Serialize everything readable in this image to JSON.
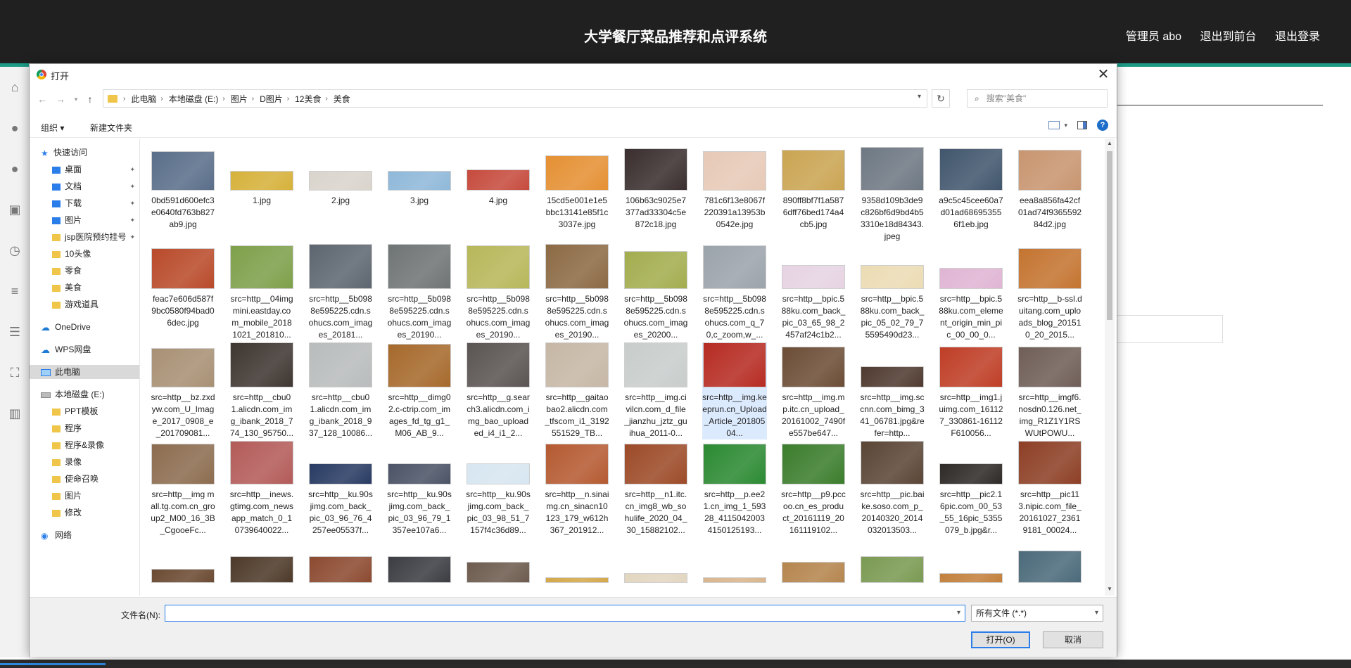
{
  "app": {
    "system_title": "大学餐厅菜品推荐和点评系统",
    "nav": {
      "admin": "管理员 abo",
      "front": "退出到前台",
      "logout": "退出登录"
    }
  },
  "dialog": {
    "title": "打开",
    "breadcrumb": [
      "此电脑",
      "本地磁盘 (E:)",
      "图片",
      "D图片",
      "12美食",
      "美食"
    ],
    "search_placeholder": "搜索\"美食\"",
    "toolbar": {
      "organize": "组织 ▾",
      "new_folder": "新建文件夹"
    },
    "nav_pane": [
      {
        "label": "快速访问",
        "icon": "star-icon",
        "indent": 0
      },
      {
        "label": "桌面",
        "icon": "desktop-icon",
        "indent": 1,
        "pinned": true
      },
      {
        "label": "文档",
        "icon": "document-icon",
        "indent": 1,
        "pinned": true
      },
      {
        "label": "下载",
        "icon": "download-icon",
        "indent": 1,
        "pinned": true
      },
      {
        "label": "图片",
        "icon": "picture-icon",
        "indent": 1,
        "pinned": true
      },
      {
        "label": "jsp医院预约挂号",
        "icon": "folder-icon",
        "indent": 1,
        "pinned": true
      },
      {
        "label": "10头像",
        "icon": "folder-icon",
        "indent": 1
      },
      {
        "label": "零食",
        "icon": "folder-icon",
        "indent": 1
      },
      {
        "label": "美食",
        "icon": "folder-icon",
        "indent": 1
      },
      {
        "label": "游戏道具",
        "icon": "folder-icon",
        "indent": 1
      },
      {
        "label": "OneDrive",
        "icon": "cloud-icon",
        "indent": 0,
        "gap": true
      },
      {
        "label": "WPS网盘",
        "icon": "cloud-icon",
        "indent": 0,
        "gap": true
      },
      {
        "label": "此电脑",
        "icon": "computer-icon",
        "indent": 0,
        "gap": true,
        "selected": true
      },
      {
        "label": "本地磁盘 (E:)",
        "icon": "drive-icon",
        "indent": 0,
        "gap": true
      },
      {
        "label": "PPT模板",
        "icon": "folder-icon",
        "indent": 1
      },
      {
        "label": "程序",
        "icon": "folder-icon",
        "indent": 1
      },
      {
        "label": "程序&录像",
        "icon": "folder-icon",
        "indent": 1
      },
      {
        "label": "录像",
        "icon": "folder-icon",
        "indent": 1
      },
      {
        "label": "使命召唤",
        "icon": "folder-icon",
        "indent": 1
      },
      {
        "label": "图片",
        "icon": "folder-icon",
        "indent": 1
      },
      {
        "label": "修改",
        "icon": "folder-icon",
        "indent": 1
      },
      {
        "label": "网络",
        "icon": "network-icon",
        "indent": 0,
        "gap": true
      }
    ],
    "files": [
      {
        "name": "0bd591d600efc3e0640fd763b827ab9.jpg",
        "color": "#5a6e8a",
        "h": 56
      },
      {
        "name": "1.jpg",
        "color": "#d6b13a",
        "h": 28
      },
      {
        "name": "2.jpg",
        "color": "#d9d4cc",
        "h": 28
      },
      {
        "name": "3.jpg",
        "color": "#8fb8d9",
        "h": 28
      },
      {
        "name": "4.jpg",
        "color": "#c64b3d",
        "h": 30
      },
      {
        "name": "15cd5e001e1e5bbc13141e85f1c3037e.jpg",
        "color": "#e59033",
        "h": 50
      },
      {
        "name": "106b63c9025e7377ad33304c5e872c18.jpg",
        "color": "#3a2e2e",
        "h": 60
      },
      {
        "name": "781c6f13e8067f220391a13953b0542e.jpg",
        "color": "#e7c9b7",
        "h": 56
      },
      {
        "name": "890ff8bf7f1a5876dff76bed174a4cb5.jpg",
        "color": "#caa452",
        "h": 58
      },
      {
        "name": "9358d109b3de9c826bf6d9bd4b53310e18d84343.jpeg",
        "color": "#6e7883",
        "h": 62
      },
      {
        "name": "a9c5c45cee60a7d01ad686953556f1eb.jpg",
        "color": "#41566d",
        "h": 60
      },
      {
        "name": "eea8a856fa42cf01ad74f936559284d2.jpg",
        "color": "#c89570",
        "h": 58
      },
      {
        "name": "feac7e606d587f9bc0580f94bad06dec.jpg",
        "color": "#b94a2a",
        "h": 58
      },
      {
        "name": "src=http__04imgmini.eastday.com_mobile_20181021_201810...",
        "color": "#7ea04a",
        "h": 62
      },
      {
        "name": "src=http__5b0988e595225.cdn.sohucs.com_images_20181...",
        "color": "#5d6670",
        "h": 66
      },
      {
        "name": "src=http__5b0988e595225.cdn.sohucs.com_images_20190...",
        "color": "#6f7475",
        "h": 66
      },
      {
        "name": "src=http__5b0988e595225.cdn.sohucs.com_images_20190...",
        "color": "#b7b75a",
        "h": 62
      },
      {
        "name": "src=http__5b0988e595225.cdn.sohucs.com_images_20190...",
        "color": "#8c6a44",
        "h": 66
      },
      {
        "name": "src=http__5b0988e595225.cdn.sohucs.com_images_20200...",
        "color": "#a3ad4e",
        "h": 54
      },
      {
        "name": "src=http__5b0988e595225.cdn.sohucs.com_q_70,c_zoom,w_...",
        "color": "#9ba3ab",
        "h": 62
      },
      {
        "name": "src=http__bpic.588ku.com_back_pic_03_65_98_2457af24c1b2...",
        "color": "#e6d3e3",
        "h": 34
      },
      {
        "name": "src=http__bpic.588ku.com_back_pic_05_02_79_75595490d23...",
        "color": "#ecdcb4",
        "h": 34
      },
      {
        "name": "src=http__bpic.588ku.com_element_origin_min_pic_00_00_0...",
        "color": "#e0b5d4",
        "h": 30
      },
      {
        "name": "src=http__b-ssl.duitang.com_uploads_blog_201510_20_2015...",
        "color": "#c47430",
        "h": 58
      },
      {
        "name": "src=http__bz.zxdyw.com_U_Image_2017_0908_e_201709081...",
        "color": "#a89074",
        "h": 56
      },
      {
        "name": "src=http__cbu01.alicdn.com_img_ibank_2018_774_130_95750...",
        "color": "#3e3631",
        "h": 90
      },
      {
        "name": "src=http__cbu01.alicdn.com_img_ibank_2018_937_128_10086...",
        "color": "#b9bcbc",
        "h": 90
      },
      {
        "name": "src=http__dimg02.c-ctrip.com_images_fd_tg_g1_M06_AB_9...",
        "color": "#a6692b",
        "h": 62
      },
      {
        "name": "src=http__g.search3.alicdn.com_img_bao_uploaded_i4_i1_2...",
        "color": "#5a5452",
        "h": 90
      },
      {
        "name": "src=http__gaitaobao2.alicdn.com_tfscom_i1_3192551529_TB...",
        "color": "#c6b7a5",
        "h": 90
      },
      {
        "name": "src=http__img.civilcn.com_d_file_jianzhu_jztz_guihua_2011-0...",
        "color": "#c8cdcc",
        "h": 66
      },
      {
        "name": "src=http__img.keeprun.cn_Upload_Article_20180504...",
        "color": "#b62b22",
        "h": 90,
        "selected": true
      },
      {
        "name": "src=http__img.mp.itc.cn_upload_20161002_7490fe557be647...",
        "color": "#6c4d36",
        "h": 58
      },
      {
        "name": "src=http__img.sccnn.com_bimg_341_06781.jpg&refer=http...",
        "color": "#4f3a30",
        "h": 30
      },
      {
        "name": "src=http__img1.juimg.com_161127_330861-16112F610056...",
        "color": "#bf3e26",
        "h": 58
      },
      {
        "name": "src=http__imgf6.nosdn0.126.net_img_R1Z1Y1RSWUtPOWU...",
        "color": "#6f5e57",
        "h": 58
      },
      {
        "name": "src=http__img mall.tg.com.cn_group2_M00_16_3B_CgooeFc...",
        "color": "#8c6c4f",
        "h": 58
      },
      {
        "name": "src=http__inews.gtimg.com_newsapp_match_0_10739640022...",
        "color": "#b35b59",
        "h": 62
      },
      {
        "name": "src=http__ku.90sjimg.com_back_pic_03_96_76_4257ee05537f...",
        "color": "#293b63",
        "h": 30
      },
      {
        "name": "src=http__ku.90sjimg.com_back_pic_03_96_79_1357ee107a6...",
        "color": "#4b5366",
        "h": 30
      },
      {
        "name": "src=http__ku.90sjimg.com_back_pic_03_98_51_7157f4c36d89...",
        "color": "#d7e6f1",
        "h": 30
      },
      {
        "name": "src=http__n.sinaimg.cn_sinacn10123_179_w612h367_201912...",
        "color": "#b55a31",
        "h": 58
      },
      {
        "name": "src=http__n1.itc.cn_img8_wb_sohulife_2020_04_30_15882102...",
        "color": "#9c4a27",
        "h": 58
      },
      {
        "name": "src=http__p.ee21.cn_img_1_59328_41150420034150125193...",
        "color": "#2b8a32",
        "h": 58
      },
      {
        "name": "src=http__p9.pccoo.cn_es_product_20161119_20161119102...",
        "color": "#3b7d2c",
        "h": 58
      },
      {
        "name": "src=http__pic.baike.soso.com_p_20140320_2014032013503...",
        "color": "#5a4536",
        "h": 62
      },
      {
        "name": "src=http__pic2.16pic.com_00_53_55_16pic_5355079_b.jpg&r...",
        "color": "#2e2a28",
        "h": 30
      },
      {
        "name": "src=http__pic113.nipic.com_file_20161027_23619181_00024...",
        "color": "#8d3f25",
        "h": 62
      },
      {
        "name": "",
        "color": "#6b4a32",
        "h": 20
      },
      {
        "name": "",
        "color": "#4d3929",
        "h": 38
      },
      {
        "name": "",
        "color": "#8c4a30",
        "h": 38
      },
      {
        "name": "",
        "color": "#3b3d42",
        "h": 38
      },
      {
        "name": "",
        "color": "#6d5b4e",
        "h": 30
      },
      {
        "name": "",
        "color": "#d4a84a",
        "h": 8
      },
      {
        "name": "",
        "color": "#e2d6c0",
        "h": 14
      },
      {
        "name": "",
        "color": "#d9b58c",
        "h": 8
      },
      {
        "name": "",
        "color": "#b5854e",
        "h": 30
      },
      {
        "name": "",
        "color": "#7a9a52",
        "h": 38
      },
      {
        "name": "",
        "color": "#c3803c",
        "h": 14
      },
      {
        "name": "",
        "color": "#4b6a7a",
        "h": 46
      }
    ],
    "filename_label": "文件名(N):",
    "filename_value": "",
    "filetype": "所有文件 (*.*)",
    "open_button": "打开(O)",
    "cancel_button": "取消"
  }
}
